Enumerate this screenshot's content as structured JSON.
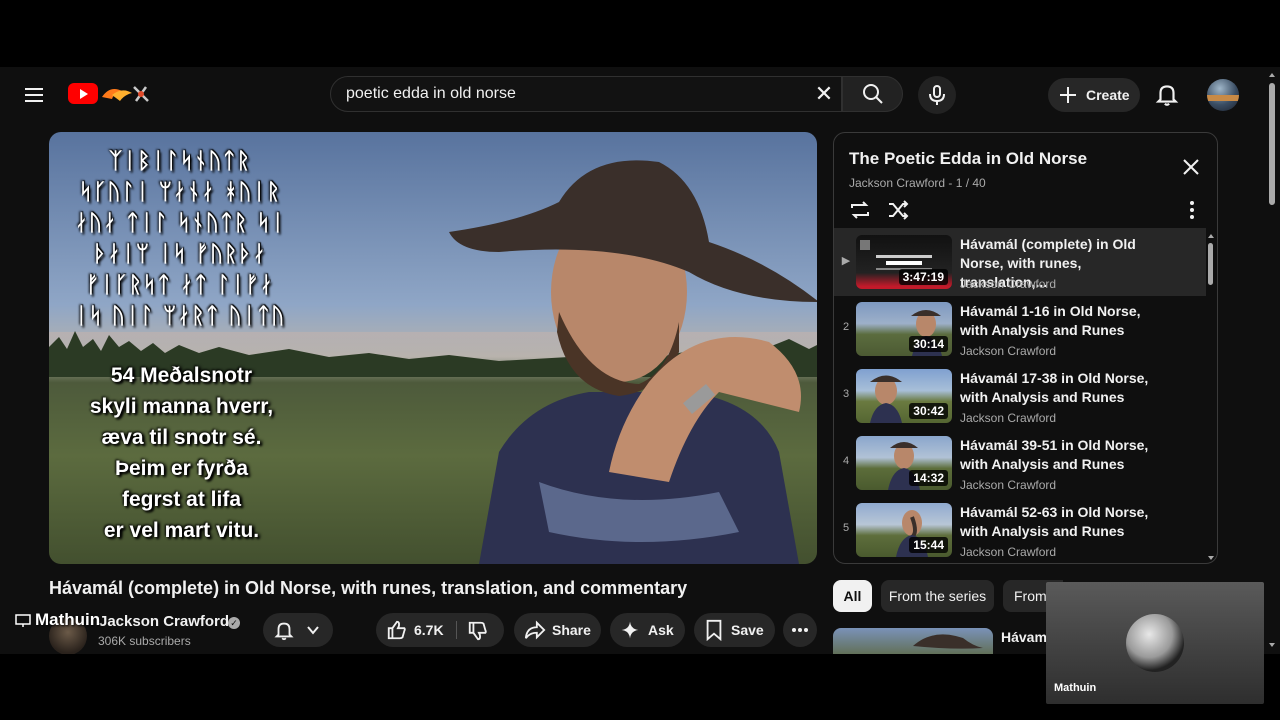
{
  "header": {
    "search_value": "poetic edda in old norse",
    "create_label": "Create"
  },
  "video": {
    "runes": [
      "ᛉᛁᛒᛁᛚᛋᚾᚢᛏᚱ",
      "ᛋᚴᚢᛚᛁ ᛘᛅᚾᛅ ᚼᚢᛁᚱ",
      "ᛅᚢᛅ ᛏᛁᛚ ᛋᚾᚢᛏᚱ ᛋᛁ",
      "ᚦᛅᛁᛘ ᛁᛋ ᚠᚢᚱᚦᛅ",
      "ᚠᛁᚴᚱᛋᛏ ᛅᛏ ᛚᛁᚠᛅ",
      "ᛁᛋ ᚢᛁᛚ ᛘᛅᚱᛏ ᚢᛁᛏᚢ"
    ],
    "verse": [
      "54 Meðalsnotr",
      "skyli manna hverr,",
      "æva til snotr sé.",
      "Þeim er fyrða",
      "fegrst at lifa",
      "er vel mart vitu."
    ],
    "title": "Hávamál (complete) in Old Norse, with runes, translation, and commentary",
    "channel": "Jackson Crawford",
    "subscribers": "306K subscribers",
    "likes": "6.7K",
    "share_label": "Share",
    "ask_label": "Ask",
    "save_label": "Save",
    "overlay_user": "Mathuin"
  },
  "playlist": {
    "title": "The Poetic Edda in Old Norse",
    "subtitle": "Jackson Crawford - 1 / 40",
    "items": [
      {
        "index": "▶",
        "title": "Hávamál (complete) in Old Norse, with runes, translation,...",
        "channel": "Jackson Crawford",
        "duration": "3:47:19",
        "active": true
      },
      {
        "index": "2",
        "title": "Hávamál 1-16 in Old Norse, with Analysis and Runes",
        "channel": "Jackson Crawford",
        "duration": "30:14"
      },
      {
        "index": "3",
        "title": "Hávamál 17-38 in Old Norse, with Analysis and Runes",
        "channel": "Jackson Crawford",
        "duration": "30:42"
      },
      {
        "index": "4",
        "title": "Hávamál 39-51 in Old Norse, with Analysis and Runes",
        "channel": "Jackson Crawford",
        "duration": "14:32"
      },
      {
        "index": "5",
        "title": "Hávamál 52-63 in Old Norse, with Analysis and Runes",
        "channel": "Jackson Crawford",
        "duration": "15:44"
      }
    ]
  },
  "chips": [
    "All",
    "From the series",
    "From"
  ],
  "recommendation": {
    "title": "Hávama"
  },
  "pip": {
    "name": "Mathuin"
  },
  "colors": {
    "brand_red": "#ff0000",
    "bg": "#0f0f0f",
    "surface": "#272727"
  }
}
